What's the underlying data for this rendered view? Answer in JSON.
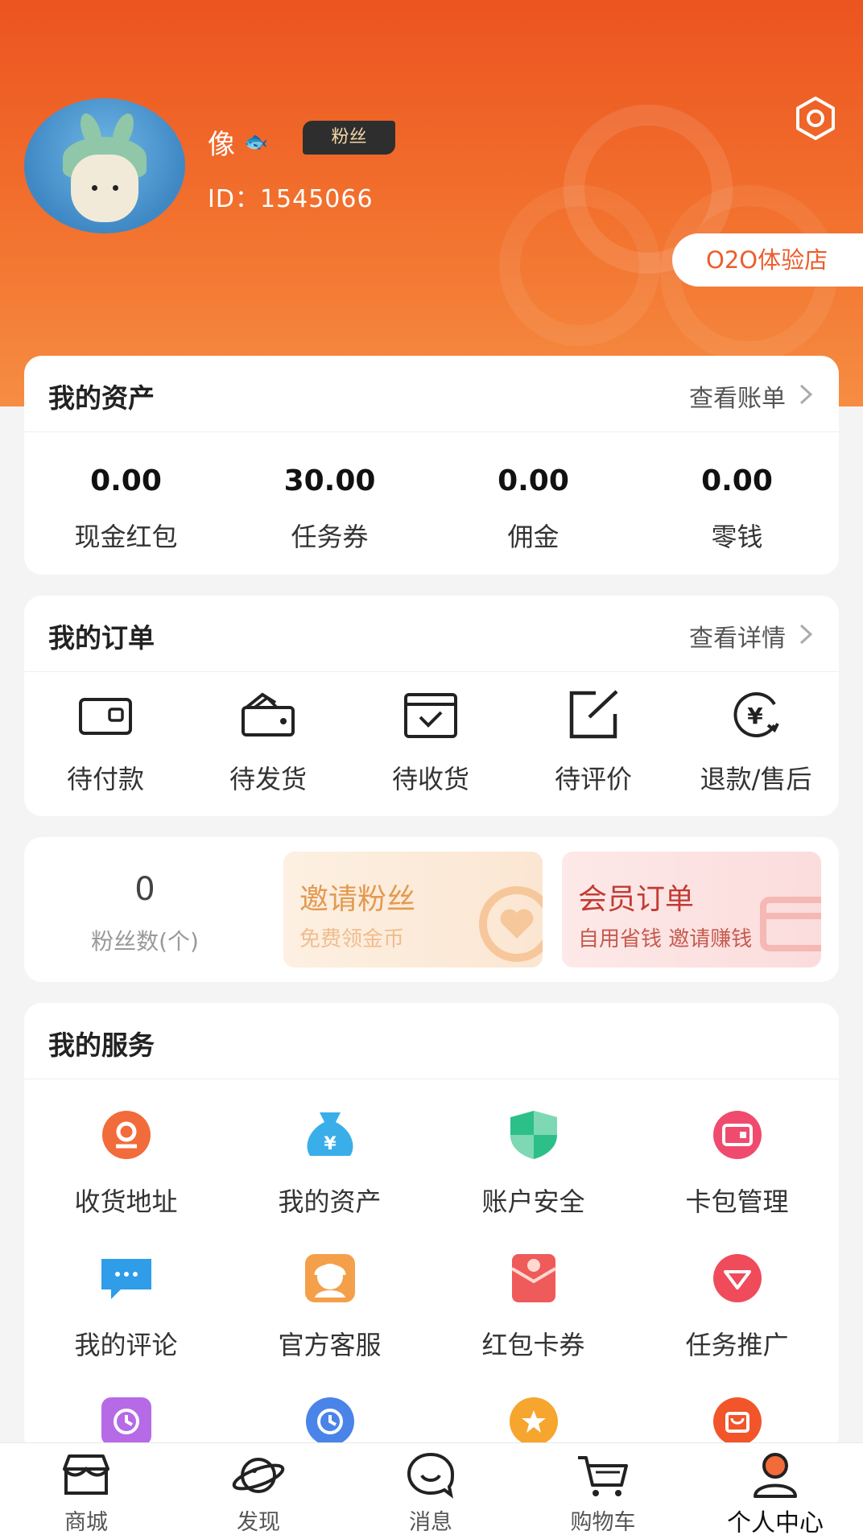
{
  "profile": {
    "username": "像",
    "fish_emoji": "🐟",
    "badge": "粉丝",
    "user_id": "ID：1545066",
    "store_button": "O2O体验店",
    "settings_icon": "settings-hexagon-icon"
  },
  "assets": {
    "title": "我的资产",
    "link": "查看账单",
    "items": [
      {
        "value": "0.00",
        "label": "现金红包"
      },
      {
        "value": "30.00",
        "label": "任务券"
      },
      {
        "value": "0.00",
        "label": "佣金"
      },
      {
        "value": "0.00",
        "label": "零钱"
      }
    ]
  },
  "orders": {
    "title": "我的订单",
    "link": "查看详情",
    "items": [
      {
        "label": "待付款",
        "icon": "wallet-icon"
      },
      {
        "label": "待发货",
        "icon": "purse-icon"
      },
      {
        "label": "待收货",
        "icon": "box-check-icon"
      },
      {
        "label": "待评价",
        "icon": "edit-icon"
      },
      {
        "label": "退款/售后",
        "icon": "refund-icon"
      }
    ]
  },
  "fans": {
    "count": "0",
    "label": "粉丝数(个)",
    "invite_title": "邀请粉丝",
    "invite_sub": "免费领金币",
    "member_title": "会员订单",
    "member_sub": "自用省钱 邀请赚钱"
  },
  "services": {
    "title": "我的服务",
    "items": [
      {
        "label": "收货地址",
        "icon": "location-icon",
        "color": "#f26b3a"
      },
      {
        "label": "我的资产",
        "icon": "money-bag-icon",
        "color": "#3aaee8"
      },
      {
        "label": "账户安全",
        "icon": "shield-icon",
        "color": "#2dbf88"
      },
      {
        "label": "卡包管理",
        "icon": "card-wallet-icon",
        "color": "#f04b6e"
      },
      {
        "label": "我的评论",
        "icon": "comment-icon",
        "color": "#2f9de8"
      },
      {
        "label": "官方客服",
        "icon": "customer-service-icon",
        "color": "#f4a04a"
      },
      {
        "label": "红包卡券",
        "icon": "red-packet-icon",
        "color": "#ef5a5a"
      },
      {
        "label": "任务推广",
        "icon": "diamond-icon",
        "color": "#f04b5b"
      },
      {
        "label": "",
        "icon": "history-icon",
        "color": "#b66ae6"
      },
      {
        "label": "",
        "icon": "clock-icon",
        "color": "#4a84e8"
      },
      {
        "label": "",
        "icon": "star-icon",
        "color": "#f6a52e"
      },
      {
        "label": "",
        "icon": "shopping-bag-icon",
        "color": "#f2552a"
      }
    ]
  },
  "tabbar": {
    "items": [
      {
        "label": "商城",
        "icon": "store-icon"
      },
      {
        "label": "发现",
        "icon": "planet-icon"
      },
      {
        "label": "消息",
        "icon": "chat-icon"
      },
      {
        "label": "购物车",
        "icon": "cart-icon"
      },
      {
        "label": "个人中心",
        "icon": "profile-icon"
      }
    ]
  },
  "colors": {
    "brand_orange": "#ec5420",
    "accent_red": "#c23b34"
  }
}
